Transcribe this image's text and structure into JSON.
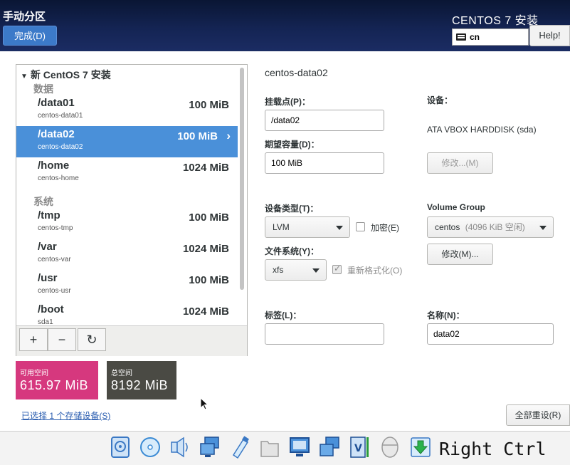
{
  "header": {
    "title": "手动分区",
    "done_label": "完成(D)",
    "product": "CENTOS 7 安装",
    "keyboard_layout": "cn",
    "help_label": "Help!"
  },
  "tree": {
    "root_label": "新 CentOS 7 安装",
    "group_data": "数据",
    "group_system": "系统",
    "rows": [
      {
        "mount": "/data01",
        "device": "centos-data01",
        "size": "100 MiB"
      },
      {
        "mount": "/data02",
        "device": "centos-data02",
        "size": "100 MiB"
      },
      {
        "mount": "/home",
        "device": "centos-home",
        "size": "1024 MiB"
      },
      {
        "mount": "/tmp",
        "device": "centos-tmp",
        "size": "100 MiB"
      },
      {
        "mount": "/var",
        "device": "centos-var",
        "size": "1024 MiB"
      },
      {
        "mount": "/usr",
        "device": "centos-usr",
        "size": "100 MiB"
      },
      {
        "mount": "/boot",
        "device": "sda1",
        "size": "1024 MiB"
      }
    ],
    "selected_index": 1,
    "add_icon": "+",
    "remove_icon": "−",
    "refresh_icon": "↻"
  },
  "space": {
    "available_label": "可用空间",
    "available_value": "615.97 MiB",
    "total_label": "总空间",
    "total_value": "8192 MiB"
  },
  "storage_link": "已选择 1 个存储设备(S)",
  "detail": {
    "title": "centos-data02",
    "mount_label": "挂载点(P)：",
    "mount_value": "/data02",
    "capacity_label": "期望容量(D)：",
    "capacity_value": "100 MiB",
    "device_label": "设备：",
    "device_value": "ATA VBOX HARDDISK (sda)",
    "modify_disabled_label": "修改...(M)",
    "device_type_label": "设备类型(T)：",
    "device_type_value": "LVM",
    "encrypt_label": "加密(E)",
    "encrypt_checked": false,
    "fs_label": "文件系统(Y)：",
    "fs_value": "xfs",
    "reformat_label": "重新格式化(O)",
    "reformat_checked": true,
    "vg_label": "Volume Group",
    "vg_value": "centos",
    "vg_free": "(4096 KiB 空闲)",
    "vg_modify_label": "修改(M)...",
    "tag_label": "标签(L)：",
    "tag_value": "",
    "name_label": "名称(N)：",
    "name_value": "data02"
  },
  "reset_label": "全部重设(R)",
  "vbox": {
    "icons": [
      "hard-disk-icon",
      "optical-disk-icon",
      "audio-icon",
      "network-icon",
      "usb-icon",
      "shared-folder-icon",
      "display-icon",
      "video-capture-icon",
      "virtualization-icon",
      "mouse-integration-icon",
      "download-arrow-icon"
    ],
    "host_key": "Right Ctrl"
  }
}
